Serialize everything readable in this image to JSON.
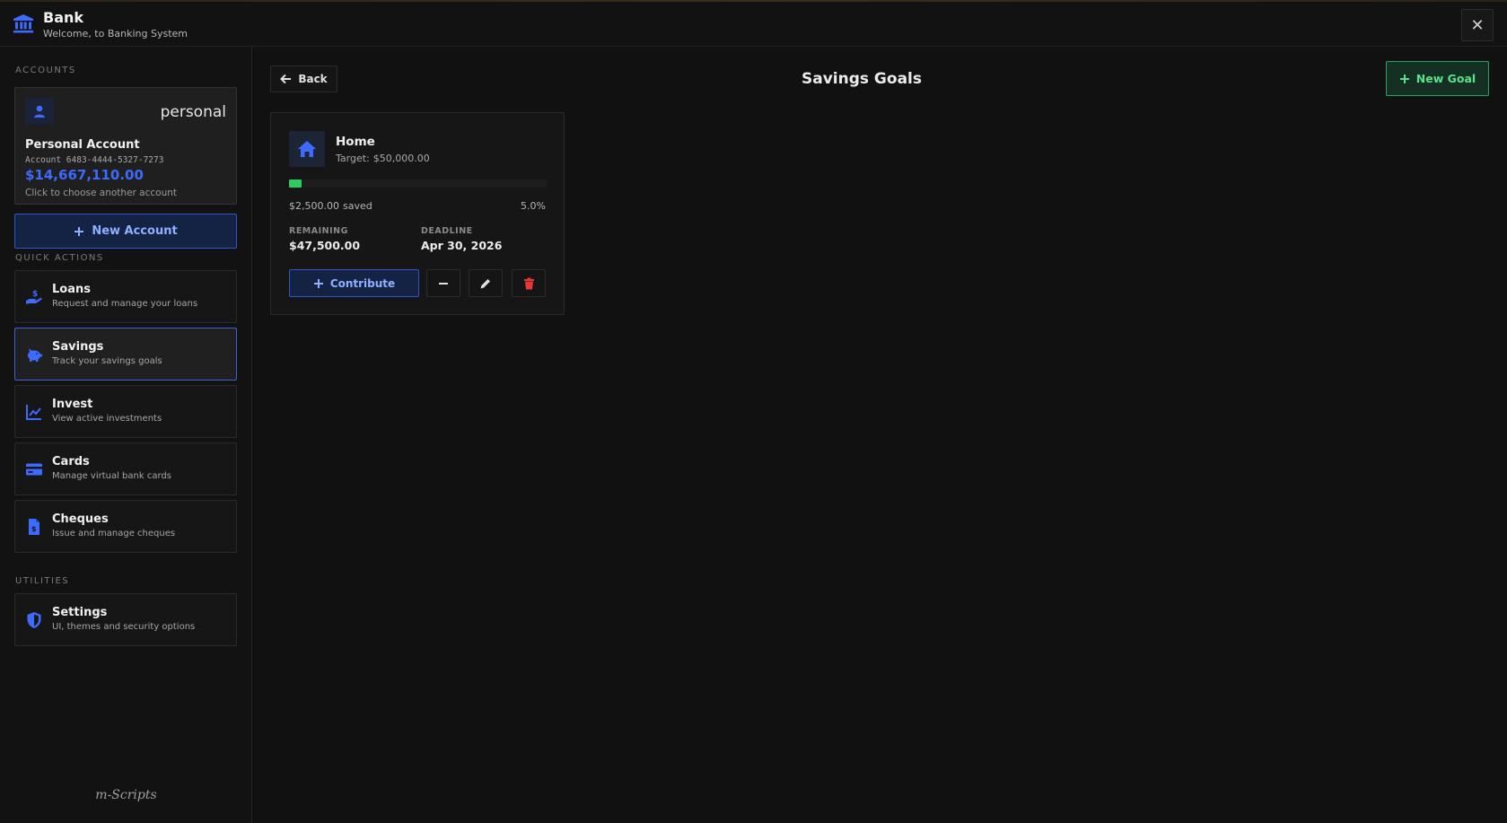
{
  "header": {
    "title": "Bank",
    "subtitle": "Welcome, to Banking System",
    "close_glyph": "✕"
  },
  "sidebar": {
    "accounts_label": "ACCOUNTS",
    "account": {
      "type": "personal",
      "name": "Personal Account",
      "number_label": "Account",
      "number": "6483-4444-5327-7273",
      "balance": "$14,667,110.00",
      "hint": "Click to choose another account"
    },
    "new_account_label": "New Account",
    "quick_actions_label": "QUICK ACTIONS",
    "quick_actions": [
      {
        "title": "Loans",
        "desc": "Request and manage your loans",
        "icon": "hand-coin-icon"
      },
      {
        "title": "Savings",
        "desc": "Track your savings goals",
        "icon": "piggy-bank-icon",
        "active": true
      },
      {
        "title": "Invest",
        "desc": "View active investments",
        "icon": "chart-line-icon"
      },
      {
        "title": "Cards",
        "desc": "Manage virtual bank cards",
        "icon": "credit-card-icon"
      },
      {
        "title": "Cheques",
        "desc": "Issue and manage cheques",
        "icon": "cheque-icon"
      }
    ],
    "utilities_label": "UTILITIES",
    "utilities": [
      {
        "title": "Settings",
        "desc": "UI, themes and security options",
        "icon": "shield-icon"
      }
    ],
    "brand": "m-Scripts"
  },
  "main": {
    "back_label": "Back",
    "title": "Savings Goals",
    "new_goal_label": "New Goal",
    "goal": {
      "name": "Home",
      "target_label": "Target:",
      "target": "$50,000.00",
      "progress_percent": 5.0,
      "saved": "$2,500.00",
      "saved_suffix": "saved",
      "percent_text": "5.0%",
      "remaining_label": "REMAINING",
      "remaining": "$47,500.00",
      "deadline_label": "DEADLINE",
      "deadline": "Apr 30, 2026",
      "contribute_label": "Contribute"
    }
  },
  "colors": {
    "accent_blue": "#3d6bff",
    "accent_green": "#2ecb61",
    "danger_red": "#e53935"
  }
}
